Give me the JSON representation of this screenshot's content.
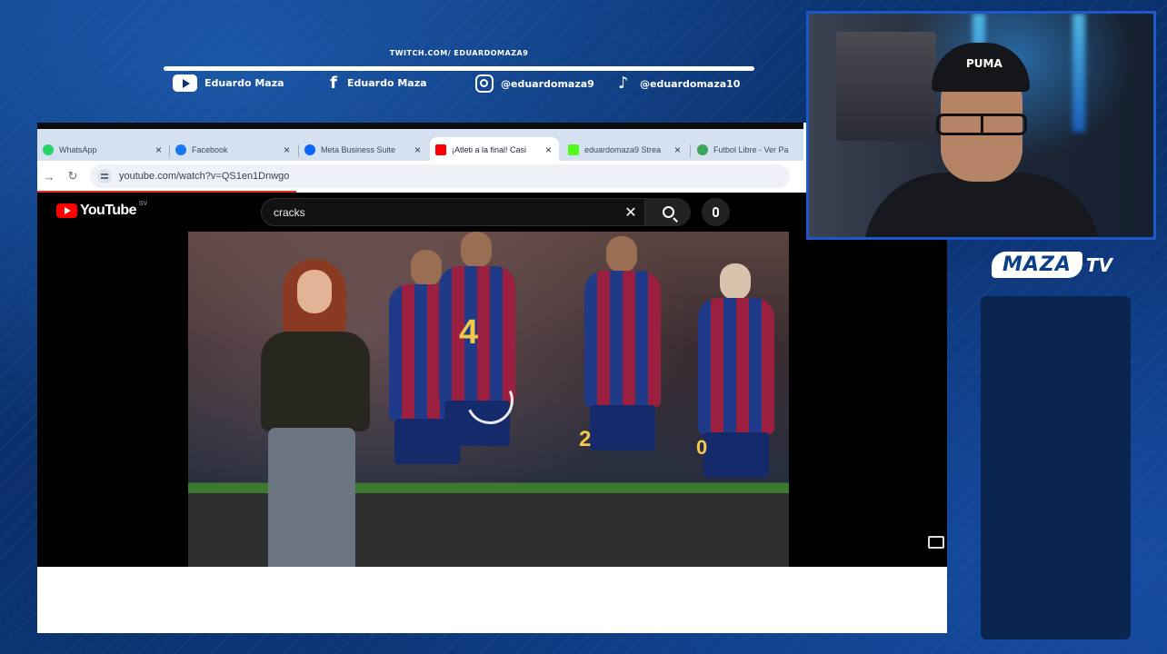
{
  "banner": {
    "twitch_url": "TWITCH.COM/ EDUARDOMAZA9",
    "socials": [
      {
        "icon": "youtube-icon",
        "label": "Eduardo Maza"
      },
      {
        "icon": "facebook-icon",
        "label": "Eduardo Maza"
      },
      {
        "icon": "instagram-icon",
        "label": "@eduardomaza9"
      },
      {
        "icon": "tiktok-icon",
        "label": "@eduardomaza10"
      }
    ]
  },
  "browser": {
    "tabs": [
      {
        "label": "WhatsApp",
        "favicon_color": "#25d366",
        "active": false
      },
      {
        "label": "Facebook",
        "favicon_color": "#1877f2",
        "active": false
      },
      {
        "label": "Meta Business Suite",
        "favicon_color": "#0866ff",
        "active": false
      },
      {
        "label": "¡Atleti a la final! Casi",
        "favicon_color": "#ff0000",
        "active": true
      },
      {
        "label": "eduardomaza9 Strea",
        "favicon_color": "#53fc18",
        "active": false
      },
      {
        "label": "Futbol Libre - Ver Pa",
        "favicon_color": "#3aa757",
        "active": false
      }
    ],
    "url": "youtube.com/watch?v=QS1en1Dnwgo"
  },
  "youtube": {
    "logo_text": "YouTube",
    "country_code": "SV",
    "search_query": "cracks",
    "player_numbers": [
      "4",
      "2",
      "0"
    ],
    "colors": {
      "brand_red": "#ff0000",
      "background": "#000000"
    }
  },
  "overlay": {
    "brand": "MAZA",
    "brand_suffix": "TV",
    "cap_logo": "PUMA",
    "accent_blue": "#1c58c9"
  }
}
